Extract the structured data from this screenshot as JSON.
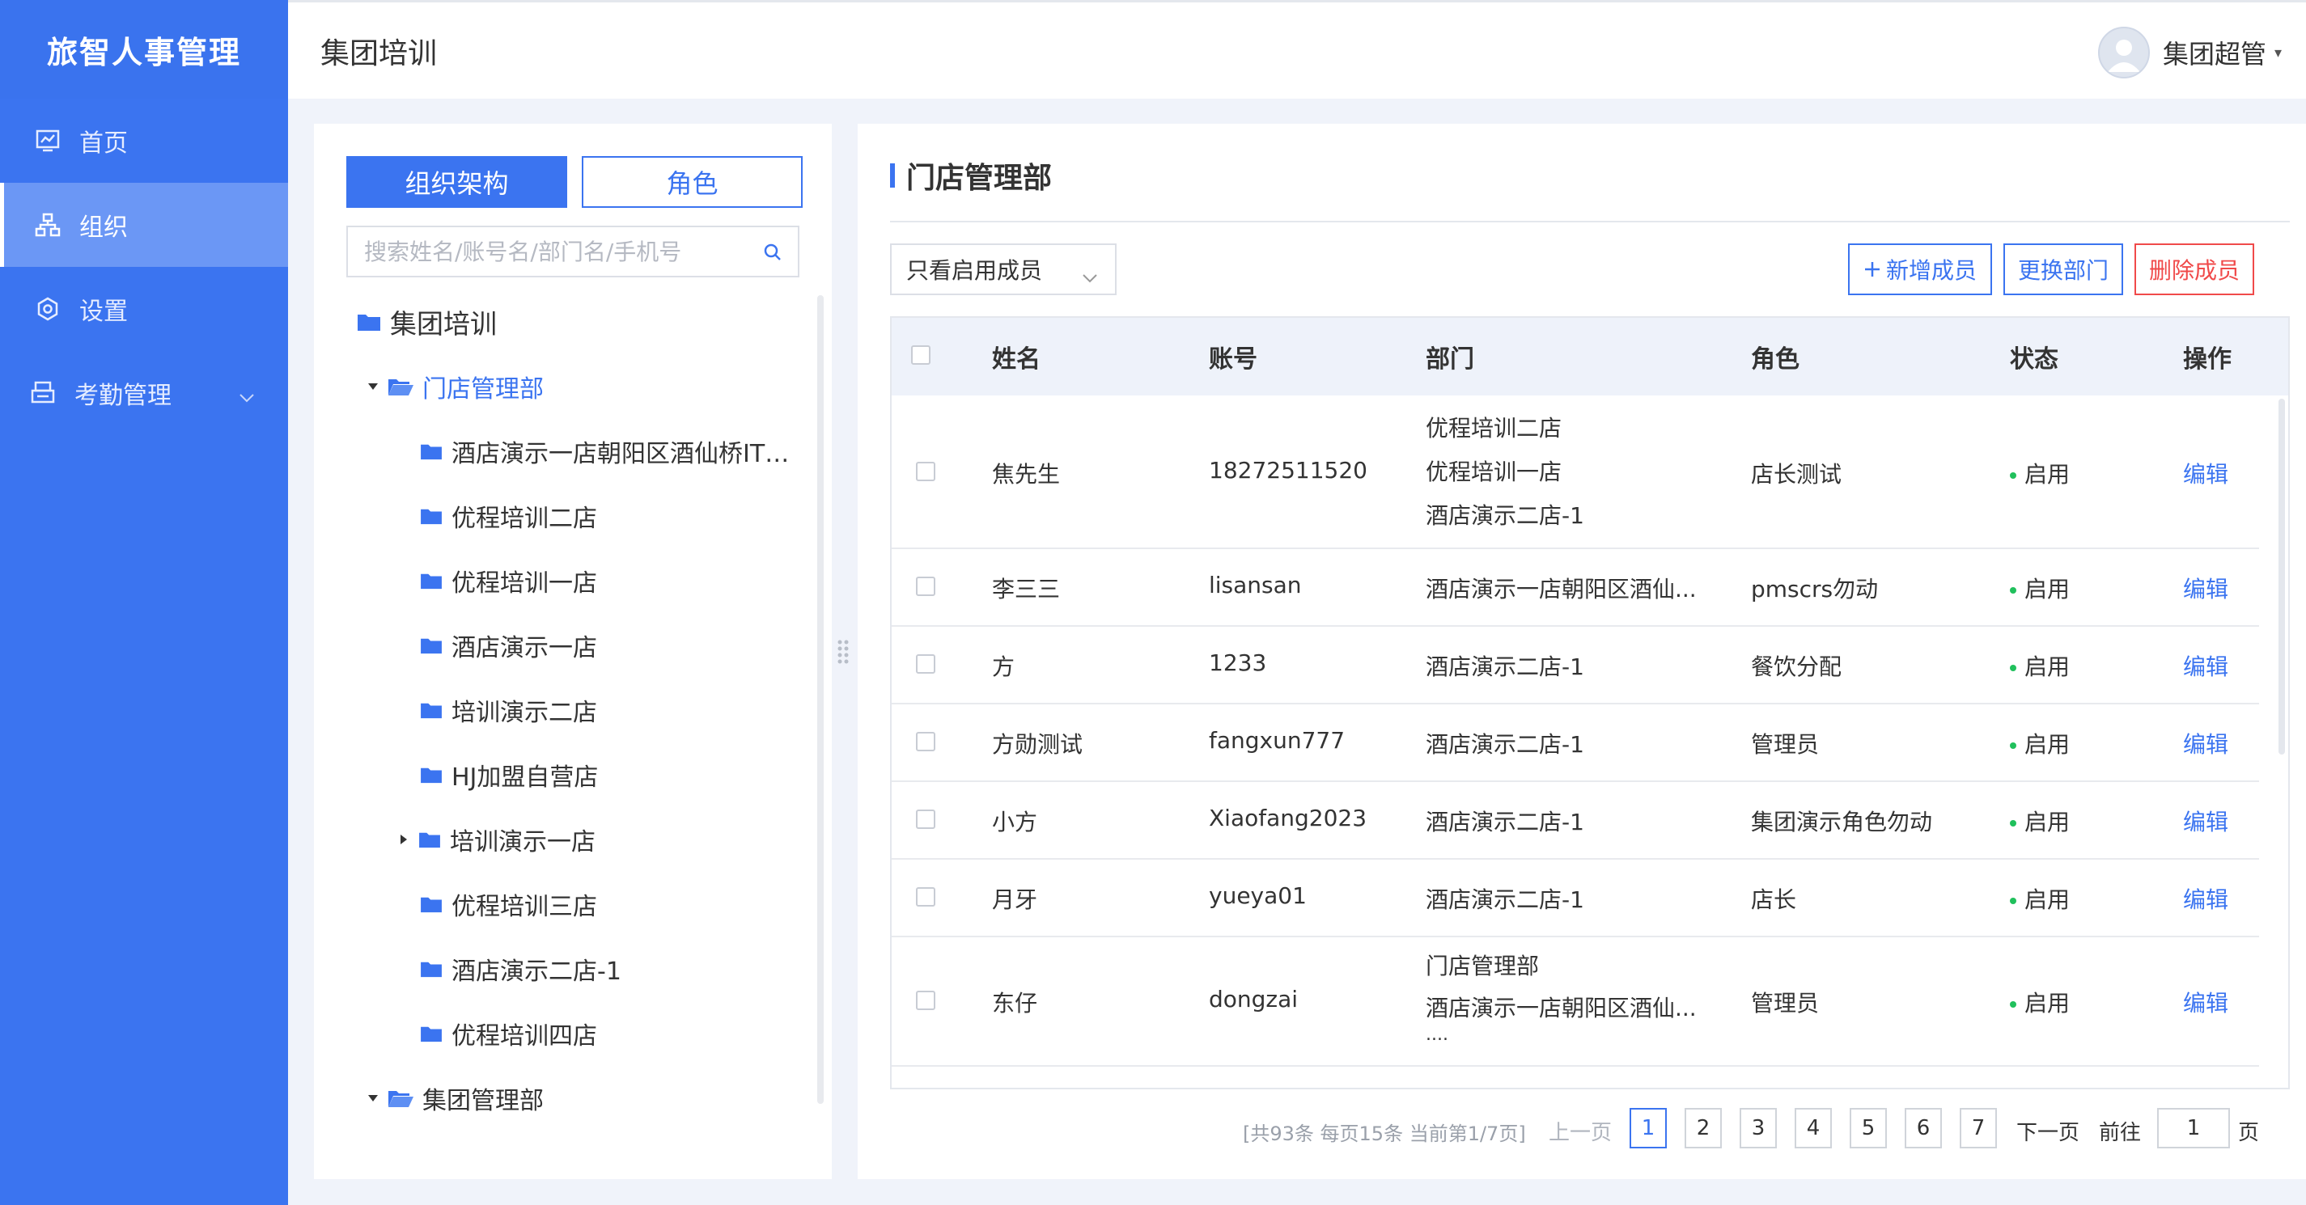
{
  "app": {
    "brand": "旅智人事管理"
  },
  "sidebar": {
    "items": [
      {
        "label": "首页",
        "icon": "dashboard-icon"
      },
      {
        "label": "组织",
        "icon": "org-chart-icon",
        "active": true
      },
      {
        "label": "设置",
        "icon": "settings-icon"
      },
      {
        "label": "考勤管理",
        "icon": "attendance-icon",
        "expandable": true
      }
    ]
  },
  "header": {
    "title": "集团培训",
    "user_name": "集团超管"
  },
  "left": {
    "tab_org": "组织架构",
    "tab_role": "角色",
    "search_placeholder": "搜索姓名/账号名/部门名/手机号",
    "tree": [
      {
        "label": "集团培训"
      },
      {
        "label": "门店管理部"
      },
      {
        "label": "酒店演示一店朝阳区酒仙桥IT电..."
      },
      {
        "label": "优程培训二店"
      },
      {
        "label": "优程培训一店"
      },
      {
        "label": "酒店演示一店"
      },
      {
        "label": "培训演示二店"
      },
      {
        "label": "HJ加盟自营店"
      },
      {
        "label": "培训演示一店"
      },
      {
        "label": "优程培训三店"
      },
      {
        "label": "酒店演示二店-1"
      },
      {
        "label": "优程培训四店"
      },
      {
        "label": "集团管理部"
      }
    ]
  },
  "right": {
    "title": "门店管理部",
    "filter_value": "只看启用成员",
    "btn_add": "新增成员",
    "btn_change": "更换部门",
    "btn_delete": "删除成员",
    "columns": {
      "name": "姓名",
      "account": "账号",
      "dept": "部门",
      "role": "角色",
      "status": "状态",
      "op": "操作"
    },
    "rows": [
      {
        "name": "焦先生",
        "account": "18272511520",
        "dept": [
          "优程培训二店",
          "优程培训一店",
          "酒店演示二店-1"
        ],
        "role": "店长测试",
        "status": "启用",
        "op": "编辑"
      },
      {
        "name": "李三三",
        "account": "lisansan",
        "dept": [
          "酒店演示一店朝阳区酒仙..."
        ],
        "role": "pmscrs勿动",
        "status": "启用",
        "op": "编辑"
      },
      {
        "name": "方",
        "account": "1233",
        "dept": [
          "酒店演示二店-1"
        ],
        "role": "餐饮分配",
        "status": "启用",
        "op": "编辑"
      },
      {
        "name": "方勋测试",
        "account": "fangxun777",
        "dept": [
          "酒店演示二店-1"
        ],
        "role": "管理员",
        "status": "启用",
        "op": "编辑"
      },
      {
        "name": "小方",
        "account": "Xiaofang2023",
        "dept": [
          "酒店演示二店-1"
        ],
        "role": "集团演示角色勿动",
        "status": "启用",
        "op": "编辑"
      },
      {
        "name": "月牙",
        "account": "yueya01",
        "dept": [
          "酒店演示二店-1"
        ],
        "role": "店长",
        "status": "启用",
        "op": "编辑"
      },
      {
        "name": "东仔",
        "account": "dongzai",
        "dept": [
          "门店管理部",
          "酒店演示一店朝阳区酒仙...",
          "...."
        ],
        "role": "管理员",
        "status": "启用",
        "op": "编辑"
      }
    ]
  },
  "pagination": {
    "summary": "[共93条 每页15条 当前第1/7页]",
    "prev": "上一页",
    "pages": [
      "1",
      "2",
      "3",
      "4",
      "5",
      "6",
      "7"
    ],
    "current": "1",
    "next": "下一页",
    "goto_label": "前往",
    "goto_value": "1",
    "goto_unit": "页"
  }
}
